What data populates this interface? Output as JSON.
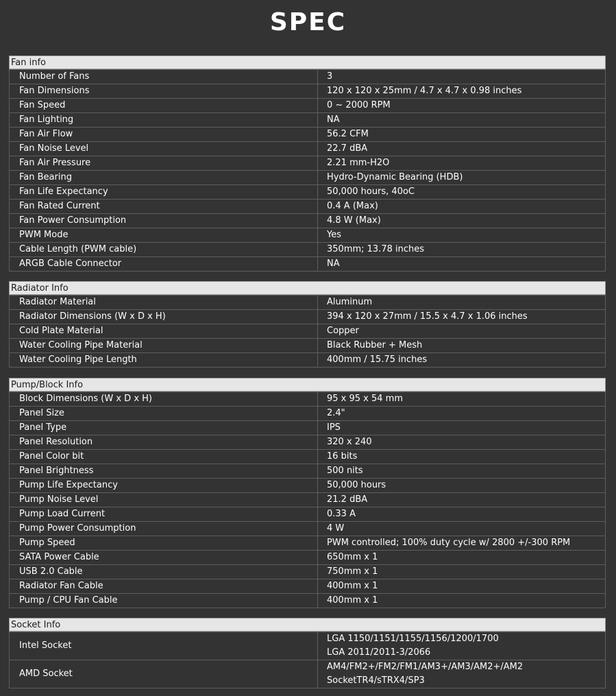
{
  "page": {
    "title": "SPEC"
  },
  "sections": [
    {
      "title": "Fan info",
      "rows": [
        {
          "label": "Number of Fans",
          "value": "3"
        },
        {
          "label": "Fan Dimensions",
          "value": "120 x 120 x 25mm / 4.7 x 4.7 x 0.98 inches"
        },
        {
          "label": "Fan Speed",
          "value": "0 ~ 2000 RPM"
        },
        {
          "label": "Fan Lighting",
          "value": "NA"
        },
        {
          "label": "Fan Air Flow",
          "value": "56.2 CFM"
        },
        {
          "label": "Fan Noise Level",
          "value": "22.7 dBA"
        },
        {
          "label": "Fan Air Pressure",
          "value": "2.21 mm-H2O"
        },
        {
          "label": "Fan Bearing",
          "value": "Hydro-Dynamic Bearing (HDB)"
        },
        {
          "label": "Fan Life Expectancy",
          "value": "50,000 hours, 40oC"
        },
        {
          "label": "Fan Rated Current",
          "value": "0.4 A (Max)"
        },
        {
          "label": "Fan Power Consumption",
          "value": "4.8 W (Max)"
        },
        {
          "label": "PWM Mode",
          "value": "Yes"
        },
        {
          "label": "Cable Length (PWM cable)",
          "value": "350mm; 13.78 inches"
        },
        {
          "label": "ARGB Cable Connector",
          "value": "NA"
        }
      ]
    },
    {
      "title": "Radiator Info",
      "rows": [
        {
          "label": "Radiator Material",
          "value": "Aluminum"
        },
        {
          "label": "Radiator Dimensions (W x D x H)",
          "value": "394 x 120 x 27mm / 15.5 x 4.7 x 1.06 inches"
        },
        {
          "label": "Cold Plate Material",
          "value": "Copper"
        },
        {
          "label": "Water Cooling Pipe Material",
          "value": "Black Rubber + Mesh"
        },
        {
          "label": "Water Cooling Pipe Length",
          "value": "400mm / 15.75 inches"
        }
      ]
    },
    {
      "title": "Pump/Block Info",
      "rows": [
        {
          "label": "Block Dimensions (W x D x H)",
          "value": "95 x 95 x 54 mm"
        },
        {
          "label": "Panel Size",
          "value": "2.4\""
        },
        {
          "label": "Panel Type",
          "value": "IPS"
        },
        {
          "label": "Panel Resolution",
          "value": "320 x 240"
        },
        {
          "label": "Panel Color bit",
          "value": "16 bits"
        },
        {
          "label": "Panel Brightness",
          "value": "500 nits"
        },
        {
          "label": "Pump Life Expectancy",
          "value": "50,000 hours"
        },
        {
          "label": "Pump Noise Level",
          "value": "21.2 dBA"
        },
        {
          "label": "Pump Load Current",
          "value": "0.33 A"
        },
        {
          "label": "Pump Power Consumption",
          "value": "4 W"
        },
        {
          "label": "Pump Speed",
          "value": "PWM controlled; 100% duty cycle w/ 2800 +/-300 RPM"
        },
        {
          "label": "SATA Power Cable",
          "value": "650mm x 1"
        },
        {
          "label": "USB 2.0 Cable",
          "value": "750mm x 1"
        },
        {
          "label": "Radiator Fan Cable",
          "value": "400mm x 1"
        },
        {
          "label": "Pump / CPU Fan Cable",
          "value": "400mm x 1"
        }
      ]
    },
    {
      "title": "Socket Info",
      "rows": [
        {
          "label": "Intel Socket",
          "lines": [
            "LGA 1150/1151/1155/1156/1200/1700",
            "LGA 2011/2011-3/2066"
          ]
        },
        {
          "label": "AMD Socket",
          "lines": [
            "AM4/FM2+/FM2/FM1/AM3+/AM3/AM2+/AM2",
            "SocketTR4/sTRX4/SP3"
          ]
        }
      ]
    }
  ]
}
